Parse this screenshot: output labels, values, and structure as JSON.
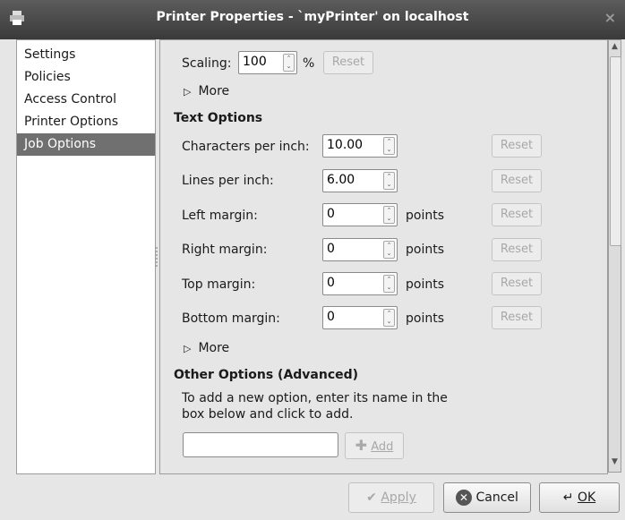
{
  "window": {
    "title": "Printer Properties - `myPrinter' on localhost",
    "close_glyph": "×"
  },
  "sidebar": {
    "items": [
      {
        "label": "Settings"
      },
      {
        "label": "Policies"
      },
      {
        "label": "Access Control"
      },
      {
        "label": "Printer Options"
      },
      {
        "label": "Job Options",
        "selected": true
      }
    ]
  },
  "scaling": {
    "label": "Scaling:",
    "value": "100",
    "unit": "%",
    "reset_label": "Reset"
  },
  "more_label": "More",
  "text_options": {
    "heading": "Text Options",
    "rows": [
      {
        "label": "Characters per inch:",
        "value": "10.00",
        "unit": "",
        "reset_label": "Reset"
      },
      {
        "label": "Lines per inch:",
        "value": "6.00",
        "unit": "",
        "reset_label": "Reset"
      },
      {
        "label": "Left margin:",
        "value": "0",
        "unit": "points",
        "reset_label": "Reset"
      },
      {
        "label": "Right margin:",
        "value": "0",
        "unit": "points",
        "reset_label": "Reset"
      },
      {
        "label": "Top margin:",
        "value": "0",
        "unit": "points",
        "reset_label": "Reset"
      },
      {
        "label": "Bottom margin:",
        "value": "0",
        "unit": "points",
        "reset_label": "Reset"
      }
    ]
  },
  "other_options": {
    "heading": "Other Options (Advanced)",
    "description_line1": "To add a new option, enter its name in the",
    "description_line2": "box below and click to add.",
    "input_value": "",
    "add_label": "Add"
  },
  "buttons": {
    "apply": "Apply",
    "cancel": "Cancel",
    "ok": "OK"
  },
  "icons": {
    "app": "printer-icon",
    "expander": "triangle-right-icon",
    "add": "plus-icon",
    "apply": "checkmark-icon",
    "cancel": "cancel-icon",
    "ok": "enter-icon"
  }
}
